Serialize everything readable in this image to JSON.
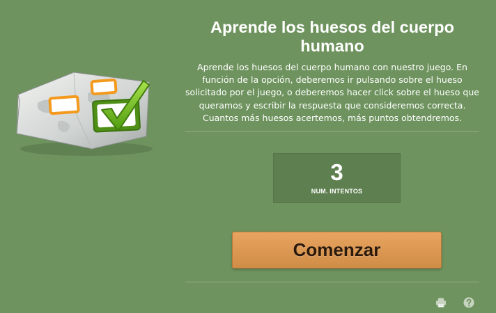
{
  "game": {
    "title": "Aprende los huesos del cuerpo humano",
    "description": "Aprende los huesos del cuerpo humano con nuestro juego. En función de la opción, deberemos ir pulsando sobre el hueso solicitado por el juego, o deberemos hacer click sobre el hueso que queramos y escribir la respuesta que consideremos correcta. Cuantos más huesos acertemos, más puntos obtendremos.",
    "illustration_icon": "map-quiz-checkmark-icon"
  },
  "attempts": {
    "value": "3",
    "label": "NUM. INTENTOS"
  },
  "start_button": {
    "label": "Comenzar"
  },
  "footer": {
    "icons": [
      "print-icon",
      "help-icon"
    ]
  },
  "colors": {
    "background": "#6e935e",
    "attempts_box": "#5e7f4f",
    "button": "#dc9a55",
    "button_text": "#2b1a0c",
    "checkmark": "#7cc22a",
    "marker": "#f39a1e"
  }
}
